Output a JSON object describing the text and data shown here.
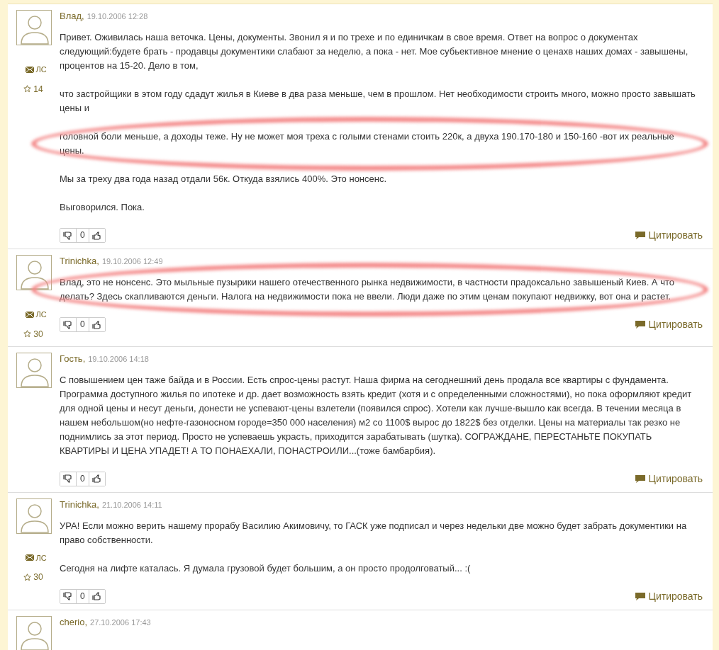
{
  "posts": [
    {
      "author": "Влад,",
      "date": "19.10.2006 12:28",
      "pm": "ЛС",
      "rating": "14",
      "votes": "0",
      "quote": "Цитировать",
      "paragraphs": [
        {
          "text": "Привет. Оживилась наша веточка. Цены, документы. Звонил я и по трехе и по единичкам в свое время. Ответ на вопрос о документах следующий:будете брать - продавцы документики слабают за неделю, а пока - нет. Мое субьективное мнение о ценахв наших домах - завышены, процентов на 15-20. Дело в том,",
          "circled": false
        },
        {
          "text": "что застройщики в этом году сдадут жилья в Киеве в два раза меньше, чем в прошлом. Нет необходимости строить много, можно просто завышать цены и",
          "circled": false
        },
        {
          "text": "головной боли меньше, а доходы теже. Ну не может моя треха с голыми стенами стоить 220к, а двуха 190.170-180 и 150-160 -вот их реальные цены.",
          "circled": true
        },
        {
          "text": "Мы за треху два года назад отдали 56к. Откуда взялись 400%. Это нонсенс.",
          "circled": false
        },
        {
          "text": "Выговорился. Пока.",
          "circled": false
        }
      ]
    },
    {
      "author": "Trinichka,",
      "date": "19.10.2006 12:49",
      "pm": "ЛС",
      "rating": "30",
      "votes": "0",
      "quote": "Цитировать",
      "paragraphs": [
        {
          "text": "Влад, это не нонсенс. Это мыльные пузырики нашего отечественного рынка недвижимости, в частности прадоксально завышеный Киев. А что делать? Здесь скапливаются деньги. Налога на недвижимости пока не ввели. Люди даже по этим ценам покупают недвижку, вот она и растет.",
          "circled": true
        }
      ]
    },
    {
      "author": "Гость,",
      "date": "19.10.2006 14:18",
      "votes": "0",
      "quote": "Цитировать",
      "paragraphs": [
        {
          "text": "С повышением цен таже байда и в России. Есть спрос-цены растут. Наша фирма на сегоднешний день продала все квартиры с фундамента. Программа доступного жилья по ипотеке и др. дает возможность взять кредит (хотя и с определенными сложностями), но пока оформляют кредит для одной цены и несут деньги, донести не успевают-цены взлетели (появился спрос). Хотели как лучше-вышло как всегда. В течении месяца в нашем небольшом(но нефте-газоносном городе=350 000 населения) м2 со 1100$ вырос до 1822$ без отделки. Цены на материалы так резко не поднимлись за этот период. Просто не успеваешь украсть, приходится зарабатывать (шутка). СОГРАЖДАНЕ, ПЕРЕСТАНЬТЕ ПОКУПАТЬ КВАРТИРЫ И ЦЕНА УПАДЕТ! А ТО ПОНАЕХАЛИ, ПОНАСТРОИЛИ...(тоже бамбарбия).",
          "circled": false
        }
      ]
    },
    {
      "author": "Trinichka,",
      "date": "21.10.2006 14:11",
      "pm": "ЛС",
      "rating": "30",
      "votes": "0",
      "quote": "Цитировать",
      "paragraphs": [
        {
          "text": "УРА! Если можно верить нашему прорабу Василию Акимовичу, то ГАСК уже подписал и через недельки две можно будет забрать документики на право собственности.",
          "circled": false
        },
        {
          "text": "Сегодня на лифте каталась. Я думала грузовой будет большим, а он просто продолговатый... :(",
          "circled": false
        }
      ]
    },
    {
      "author": "cherio,",
      "date": "27.10.2006 17:43"
    }
  ]
}
